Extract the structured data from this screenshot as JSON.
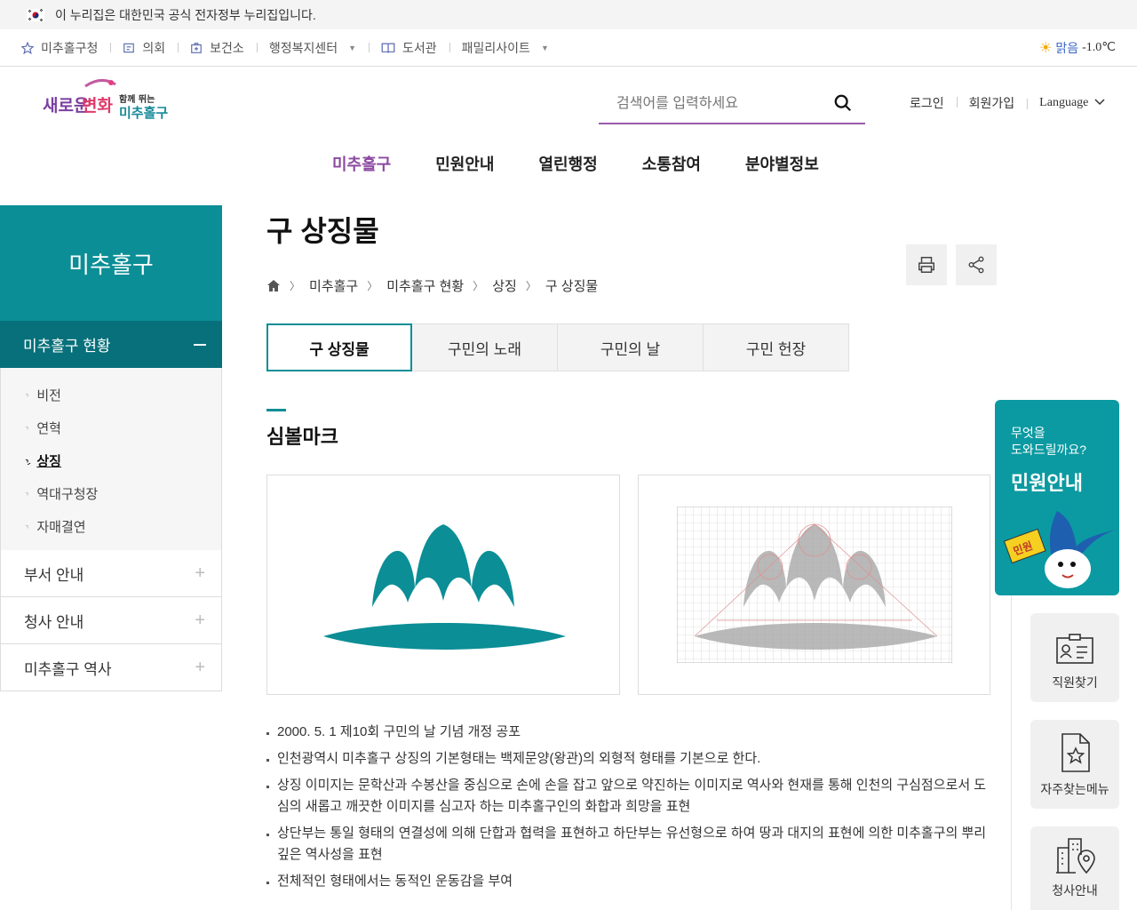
{
  "gov_banner": {
    "text": "이 누리집은 대한민국 공식 전자정부 누리집입니다."
  },
  "utilbar": {
    "items": [
      {
        "label": "미추홀구청",
        "icon": "star-icon",
        "dropdown": false
      },
      {
        "label": "의회",
        "icon": "podium-icon",
        "dropdown": false
      },
      {
        "label": "보건소",
        "icon": "medical-bag-icon",
        "dropdown": false
      },
      {
        "label": "행정복지센터",
        "icon": "",
        "dropdown": true
      },
      {
        "label": "도서관",
        "icon": "book-icon",
        "dropdown": false
      },
      {
        "label": "패밀리사이트",
        "icon": "",
        "dropdown": true
      }
    ],
    "weather": {
      "condition": "맑음",
      "temp": "-1.0℃",
      "icon": "sun-icon"
    }
  },
  "header": {
    "logo_main": "새로운 변화",
    "logo_sub_small": "함께 뛰는",
    "logo_sub": "미추홀구",
    "search_placeholder": "검색어를 입력하세요",
    "member_links": [
      "로그인",
      "회원가입"
    ],
    "language": "Language",
    "gnb": [
      "미추홀구",
      "민원안내",
      "열린행정",
      "소통참여",
      "분야별정보"
    ]
  },
  "sidebar": {
    "title": "미추홀구",
    "active_menu": "미추홀구 현황",
    "sub_items": [
      "비전",
      "연혁",
      "상징",
      "역대구청장",
      "자매결연"
    ],
    "active_sub": "상징",
    "menus": [
      "부서 안내",
      "청사 안내",
      "미추홀구 역사"
    ]
  },
  "content": {
    "title": "구 상징물",
    "breadcrumb": [
      "미추홀구",
      "미추홀구 현황",
      "상징",
      "구 상징물"
    ],
    "tabs": [
      "구 상징물",
      "구민의 노래",
      "구민의 날",
      "구민 헌장"
    ],
    "active_tab": "구 상징물",
    "section_title": "심볼마크",
    "description": [
      "2000. 5. 1 제10회 구민의 날 기념 개정 공포",
      "인천광역시 미추홀구 상징의 기본형태는 백제문양(왕관)의 외형적 형태를 기본으로 한다.",
      "상징 이미지는 문학산과 수봉산을 중심으로 손에 손을 잡고 앞으로 약진하는 이미지로 역사와 현재를 통해 인천의 구심점으로서 도심의 새롭고 깨끗한 이미지를 심고자 하는 미추홀구인의 화합과 희망을 표현",
      "상단부는 통일 형태의 연결성에 의해 단합과 협력을 표현하고 하단부는 유선형으로 하여 땅과 대지의 표현에 의한 미추홀구의 뿌리깊은 역사성을 표현",
      "전체적인 형태에서는 동적인 운동감을 부여"
    ],
    "symbol_color": "#0b8e96"
  },
  "quick": {
    "banner_line1": "무엇을",
    "banner_line2": "도와드릴까요?",
    "banner_title": "민원안내",
    "mascot_sign": "민원",
    "buttons": [
      "직원찾기",
      "자주찾는메뉴",
      "청사안내"
    ]
  },
  "colors": {
    "accent": "#0b8e96",
    "dark_accent": "#07707a",
    "gnb_active": "#8c4aa0"
  }
}
